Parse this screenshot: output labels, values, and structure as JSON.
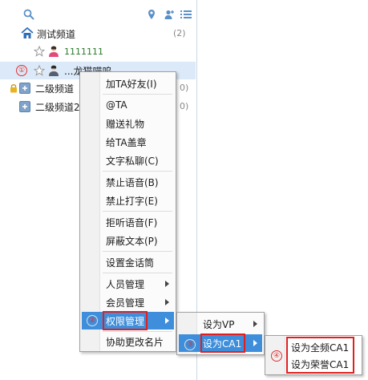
{
  "colors": {
    "accent": "#3e8edb",
    "highlight_text": "#ffffff",
    "annotation_red": "#e02020",
    "selected_row": "#dbe9f9"
  },
  "toolbar": {
    "icons": [
      "search-icon",
      "location-pin-icon",
      "add-user-icon",
      "list-icon"
    ]
  },
  "tree": {
    "channel": {
      "name": "测试频道",
      "count": "(2)",
      "icon": "home-icon"
    },
    "user1": {
      "name": "1111111",
      "icon": "user-icon"
    },
    "user2": {
      "marker": "①",
      "name": "...龙猫喵呜",
      "icon": "user-icon"
    },
    "sub1": {
      "name": "二级频道",
      "count": "0)"
    },
    "sub2": {
      "name": "二级频道2",
      "count": "0)"
    }
  },
  "context_menu": {
    "items": [
      {
        "label": "加TA好友(I)"
      },
      {
        "label": "@TA"
      },
      {
        "label": "赠送礼物"
      },
      {
        "label": "给TA盖章"
      },
      {
        "label": "文字私聊(C)"
      },
      {
        "label": "禁止语音(B)"
      },
      {
        "label": "禁止打字(E)"
      },
      {
        "label": "拒听语音(F)"
      },
      {
        "label": "屏蔽文本(P)"
      },
      {
        "label": "设置金话筒"
      },
      {
        "label": "人员管理"
      },
      {
        "label": "会员管理"
      },
      {
        "label": "权限管理",
        "marker": "②"
      },
      {
        "label": "协助更改名片"
      }
    ]
  },
  "submenu": {
    "items": [
      {
        "label": "设为VP"
      },
      {
        "label": "设为CA1",
        "marker": "③"
      }
    ]
  },
  "submenu2": {
    "marker": "④",
    "items": [
      {
        "label": "设为全频CA1"
      },
      {
        "label": "设为荣誉CA1"
      }
    ]
  }
}
